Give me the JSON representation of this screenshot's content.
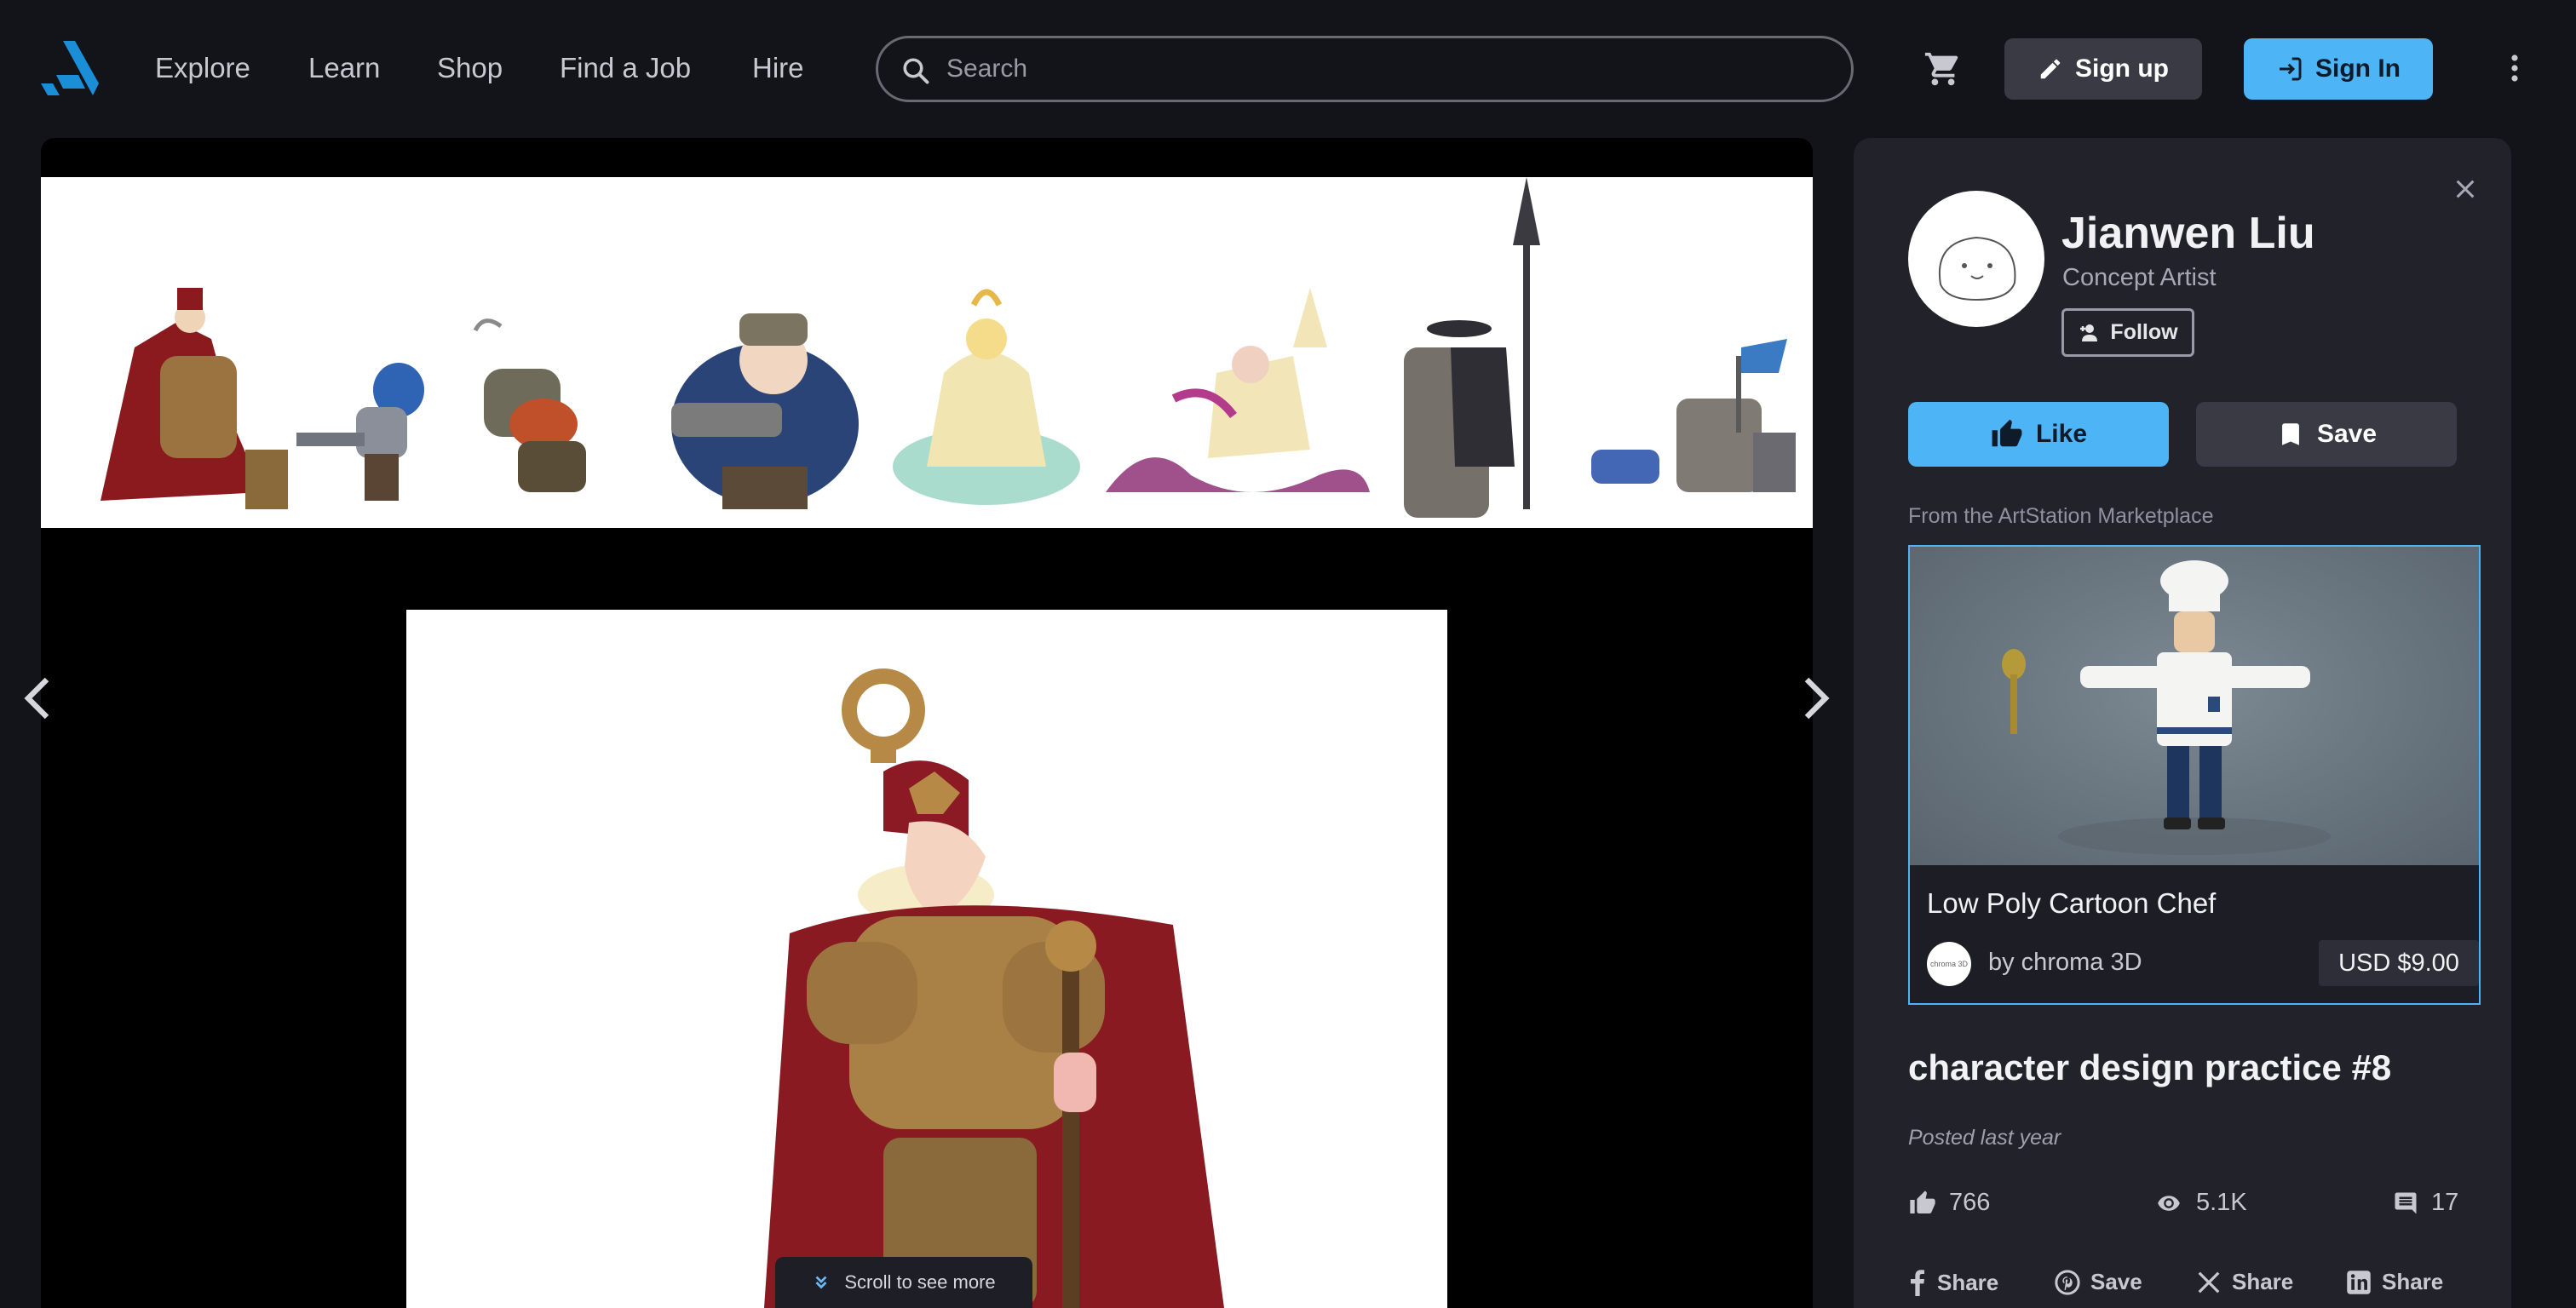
{
  "nav": {
    "items": [
      {
        "label": "Explore"
      },
      {
        "label": "Learn"
      },
      {
        "label": "Shop"
      },
      {
        "label": "Find a Job"
      },
      {
        "label": "Hire"
      }
    ]
  },
  "search": {
    "placeholder": "Search",
    "value": ""
  },
  "header_actions": {
    "signup_label": "Sign up",
    "signin_label": "Sign In"
  },
  "viewer": {
    "scroll_hint": "Scroll to see more"
  },
  "artist": {
    "name": "Jianwen Liu",
    "role": "Concept Artist",
    "follow_label": "Follow"
  },
  "actions": {
    "like_label": "Like",
    "save_label": "Save"
  },
  "marketplace": {
    "label": "From the ArtStation Marketplace",
    "product_title": "Low Poly Cartoon Chef",
    "seller": "by chroma 3D",
    "seller_logo_text": "chroma 3D",
    "price": "USD $9.00"
  },
  "artwork": {
    "title": "character design practice #8",
    "posted": "Posted last year",
    "likes": "766",
    "views": "5.1K",
    "comments": "17"
  },
  "share": {
    "facebook": "Share",
    "pinterest": "Save",
    "x": "Share",
    "linkedin": "Share"
  },
  "colors": {
    "background": "#13131a",
    "panel": "#22222b",
    "accent": "#4db4f5",
    "secondary_button": "#3a3a44"
  }
}
